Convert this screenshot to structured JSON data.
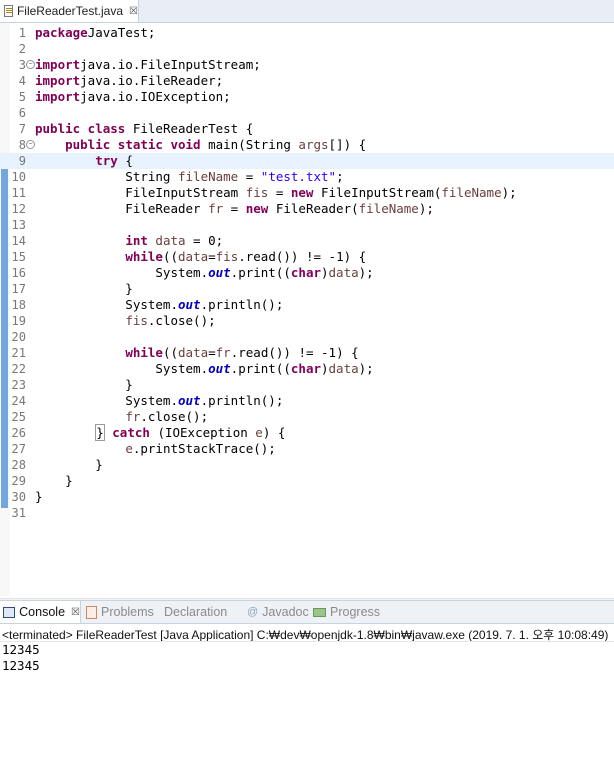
{
  "editor_tab": {
    "title": "FileReaderTest.java",
    "close": "☒"
  },
  "code_lines": [
    {
      "n": "1",
      "parts": [
        [
          "kw",
          "package"
        ],
        [
          "",
          "JavaTest;"
        ]
      ]
    },
    {
      "n": "2",
      "parts": []
    },
    {
      "n": "3",
      "fold": true,
      "parts": [
        [
          "kw",
          "import"
        ],
        [
          "",
          "java.io.FileInputStream;"
        ]
      ]
    },
    {
      "n": "4",
      "parts": [
        [
          "kw",
          "import"
        ],
        [
          "",
          "java.io.FileReader;"
        ]
      ]
    },
    {
      "n": "5",
      "parts": [
        [
          "kw",
          "import"
        ],
        [
          "",
          "java.io.IOException;"
        ]
      ]
    },
    {
      "n": "6",
      "parts": []
    },
    {
      "n": "7",
      "parts": [
        [
          "kw",
          "public class"
        ],
        [
          "",
          " FileReaderTest {"
        ]
      ]
    },
    {
      "n": "8",
      "fold": true,
      "parts": [
        [
          "",
          "    "
        ],
        [
          "kw",
          "public static void"
        ],
        [
          "",
          " main(String "
        ],
        [
          "var",
          "args"
        ],
        [
          "",
          "[]) {"
        ]
      ]
    },
    {
      "n": "9",
      "current": true,
      "parts": [
        [
          "",
          "        "
        ],
        [
          "kw",
          "try"
        ],
        [
          "",
          " {"
        ]
      ]
    },
    {
      "n": "10",
      "parts": [
        [
          "",
          "            String "
        ],
        [
          "var",
          "fileName"
        ],
        [
          "",
          " = "
        ],
        [
          "str",
          "\"test.txt\""
        ],
        [
          "",
          ";"
        ]
      ]
    },
    {
      "n": "11",
      "parts": [
        [
          "",
          "            FileInputStream "
        ],
        [
          "var",
          "fis"
        ],
        [
          "",
          " = "
        ],
        [
          "kw",
          "new"
        ],
        [
          "",
          " FileInputStream("
        ],
        [
          "var",
          "fileName"
        ],
        [
          "",
          ");"
        ]
      ]
    },
    {
      "n": "12",
      "parts": [
        [
          "",
          "            FileReader "
        ],
        [
          "var",
          "fr"
        ],
        [
          "",
          " = "
        ],
        [
          "kw",
          "new"
        ],
        [
          "",
          " FileReader("
        ],
        [
          "var",
          "fileName"
        ],
        [
          "",
          ");"
        ]
      ]
    },
    {
      "n": "13",
      "parts": []
    },
    {
      "n": "14",
      "parts": [
        [
          "",
          "            "
        ],
        [
          "kw",
          "int"
        ],
        [
          "",
          " "
        ],
        [
          "var",
          "data"
        ],
        [
          "",
          " = 0;"
        ]
      ]
    },
    {
      "n": "15",
      "parts": [
        [
          "",
          "            "
        ],
        [
          "kw",
          "while"
        ],
        [
          "",
          "(("
        ],
        [
          "var",
          "data"
        ],
        [
          "",
          "="
        ],
        [
          "var",
          "fis"
        ],
        [
          "",
          ".read()) != -1) {"
        ]
      ]
    },
    {
      "n": "16",
      "parts": [
        [
          "",
          "                System."
        ],
        [
          "fld",
          "out"
        ],
        [
          "",
          ".print(("
        ],
        [
          "kw",
          "char"
        ],
        [
          "",
          ")"
        ],
        [
          "var",
          "data"
        ],
        [
          "",
          ");"
        ]
      ]
    },
    {
      "n": "17",
      "parts": [
        [
          "",
          "            }"
        ]
      ]
    },
    {
      "n": "18",
      "parts": [
        [
          "",
          "            System."
        ],
        [
          "fld",
          "out"
        ],
        [
          "",
          ".println();"
        ]
      ]
    },
    {
      "n": "19",
      "parts": [
        [
          "",
          "            "
        ],
        [
          "var",
          "fis"
        ],
        [
          "",
          ".close();"
        ]
      ]
    },
    {
      "n": "20",
      "parts": []
    },
    {
      "n": "21",
      "parts": [
        [
          "",
          "            "
        ],
        [
          "kw",
          "while"
        ],
        [
          "",
          "(("
        ],
        [
          "var",
          "data"
        ],
        [
          "",
          "="
        ],
        [
          "var",
          "fr"
        ],
        [
          "",
          ".read()) != -1) {"
        ]
      ]
    },
    {
      "n": "22",
      "parts": [
        [
          "",
          "                System."
        ],
        [
          "fld",
          "out"
        ],
        [
          "",
          ".print(("
        ],
        [
          "kw",
          "char"
        ],
        [
          "",
          ")"
        ],
        [
          "var",
          "data"
        ],
        [
          "",
          ");"
        ]
      ]
    },
    {
      "n": "23",
      "parts": [
        [
          "",
          "            }"
        ]
      ]
    },
    {
      "n": "24",
      "parts": [
        [
          "",
          "            System."
        ],
        [
          "fld",
          "out"
        ],
        [
          "",
          ".println();"
        ]
      ]
    },
    {
      "n": "25",
      "parts": [
        [
          "",
          "            "
        ],
        [
          "var",
          "fr"
        ],
        [
          "",
          ".close();"
        ]
      ]
    },
    {
      "n": "26",
      "parts": [
        [
          "",
          "        "
        ],
        [
          "box",
          "}"
        ],
        [
          "",
          " "
        ],
        [
          "kw",
          "catch"
        ],
        [
          "",
          " (IOException "
        ],
        [
          "var",
          "e"
        ],
        [
          "",
          ") {"
        ]
      ]
    },
    {
      "n": "27",
      "parts": [
        [
          "",
          "            "
        ],
        [
          "var",
          "e"
        ],
        [
          "",
          ".printStackTrace();"
        ]
      ]
    },
    {
      "n": "28",
      "parts": [
        [
          "",
          "        }"
        ]
      ]
    },
    {
      "n": "29",
      "parts": [
        [
          "",
          "    }"
        ]
      ]
    },
    {
      "n": "30",
      "parts": [
        [
          "",
          "}"
        ]
      ]
    },
    {
      "n": "31",
      "parts": []
    }
  ],
  "scroll_arrow": "<",
  "console_tabs": [
    {
      "label": "Console",
      "icon": "console-icon",
      "close": "☒",
      "active": true
    },
    {
      "label": "Problems",
      "icon": "problems-icon"
    },
    {
      "label": "Declaration",
      "icon": "declaration-icon"
    },
    {
      "label": "Javadoc",
      "icon": "javadoc-icon",
      "glyph": "@"
    },
    {
      "label": "Progress",
      "icon": "progress-icon"
    }
  ],
  "console": {
    "header": "<terminated> FileReaderTest [Java Application] C:₩dev₩openjdk-1.8₩bin₩javaw.exe (2019. 7. 1. 오후 10:08:49)",
    "output": [
      "12345",
      "12345"
    ]
  },
  "colors": {
    "keyword": "#7f0055",
    "string": "#2a00ff",
    "variable": "#6a3e3e",
    "field": "#0000c0",
    "change_bar": "#73a6df"
  }
}
